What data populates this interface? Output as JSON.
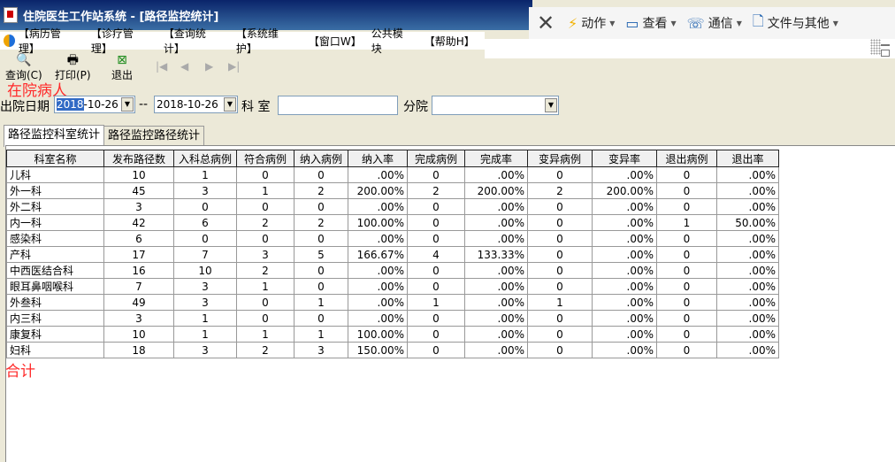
{
  "window": {
    "title": "住院医生工作站系统 - [路径监控统计]"
  },
  "float_toolbar": {
    "items": [
      {
        "label": "动作",
        "icon": "lightning-icon"
      },
      {
        "label": "查看",
        "icon": "monitor-icon"
      },
      {
        "label": "通信",
        "icon": "phone-icon"
      },
      {
        "label": "文件与其他",
        "icon": "file-add-icon"
      }
    ]
  },
  "menu": {
    "items": [
      "【病历管理】",
      "【诊疗管理】",
      "【查询统计】",
      "【系统维护】",
      "【窗口W】",
      "公共模块",
      "【帮助H】"
    ]
  },
  "toolbar": {
    "query_label": "查询(C)",
    "print_label": "打印(P)",
    "exit_label": "退出"
  },
  "annotations": {
    "inpatient": "在院病人",
    "total": "合计"
  },
  "filter": {
    "discharge_date_label": "出院日期",
    "date_from_year": "2018",
    "date_from_rest": "-10-26",
    "separator": "--",
    "date_to": "2018-10-26",
    "dept_label": "科 室",
    "hospital_label": "分院"
  },
  "tabs": [
    "路径监控科室统计",
    "路径监控路径统计"
  ],
  "table": {
    "columns": [
      "科室名称",
      "发布路径数",
      "入科总病例",
      "符合病例",
      "纳入病例",
      "纳入率",
      "完成病例",
      "完成率",
      "变异病例",
      "变异率",
      "退出病例",
      "退出率"
    ],
    "rows": [
      [
        "儿科",
        "10",
        "1",
        "0",
        "0",
        ".00%",
        "0",
        ".00%",
        "0",
        ".00%",
        "0",
        ".00%"
      ],
      [
        "外一科",
        "45",
        "3",
        "1",
        "2",
        "200.00%",
        "2",
        "200.00%",
        "2",
        "200.00%",
        "0",
        ".00%"
      ],
      [
        "外二科",
        "3",
        "0",
        "0",
        "0",
        ".00%",
        "0",
        ".00%",
        "0",
        ".00%",
        "0",
        ".00%"
      ],
      [
        "内一科",
        "42",
        "6",
        "2",
        "2",
        "100.00%",
        "0",
        ".00%",
        "0",
        ".00%",
        "1",
        "50.00%"
      ],
      [
        "感染科",
        "6",
        "0",
        "0",
        "0",
        ".00%",
        "0",
        ".00%",
        "0",
        ".00%",
        "0",
        ".00%"
      ],
      [
        "产科",
        "17",
        "7",
        "3",
        "5",
        "166.67%",
        "4",
        "133.33%",
        "0",
        ".00%",
        "0",
        ".00%"
      ],
      [
        "中西医结合科",
        "16",
        "10",
        "2",
        "0",
        ".00%",
        "0",
        ".00%",
        "0",
        ".00%",
        "0",
        ".00%"
      ],
      [
        "眼耳鼻咽喉科",
        "7",
        "3",
        "1",
        "0",
        ".00%",
        "0",
        ".00%",
        "0",
        ".00%",
        "0",
        ".00%"
      ],
      [
        "外叁科",
        "49",
        "3",
        "0",
        "1",
        ".00%",
        "1",
        ".00%",
        "1",
        ".00%",
        "0",
        ".00%"
      ],
      [
        "内三科",
        "3",
        "1",
        "0",
        "0",
        ".00%",
        "0",
        ".00%",
        "0",
        ".00%",
        "0",
        ".00%"
      ],
      [
        "康复科",
        "10",
        "1",
        "1",
        "1",
        "100.00%",
        "0",
        ".00%",
        "0",
        ".00%",
        "0",
        ".00%"
      ],
      [
        "妇科",
        "18",
        "3",
        "2",
        "3",
        "150.00%",
        "0",
        ".00%",
        "0",
        ".00%",
        "0",
        ".00%"
      ]
    ]
  }
}
